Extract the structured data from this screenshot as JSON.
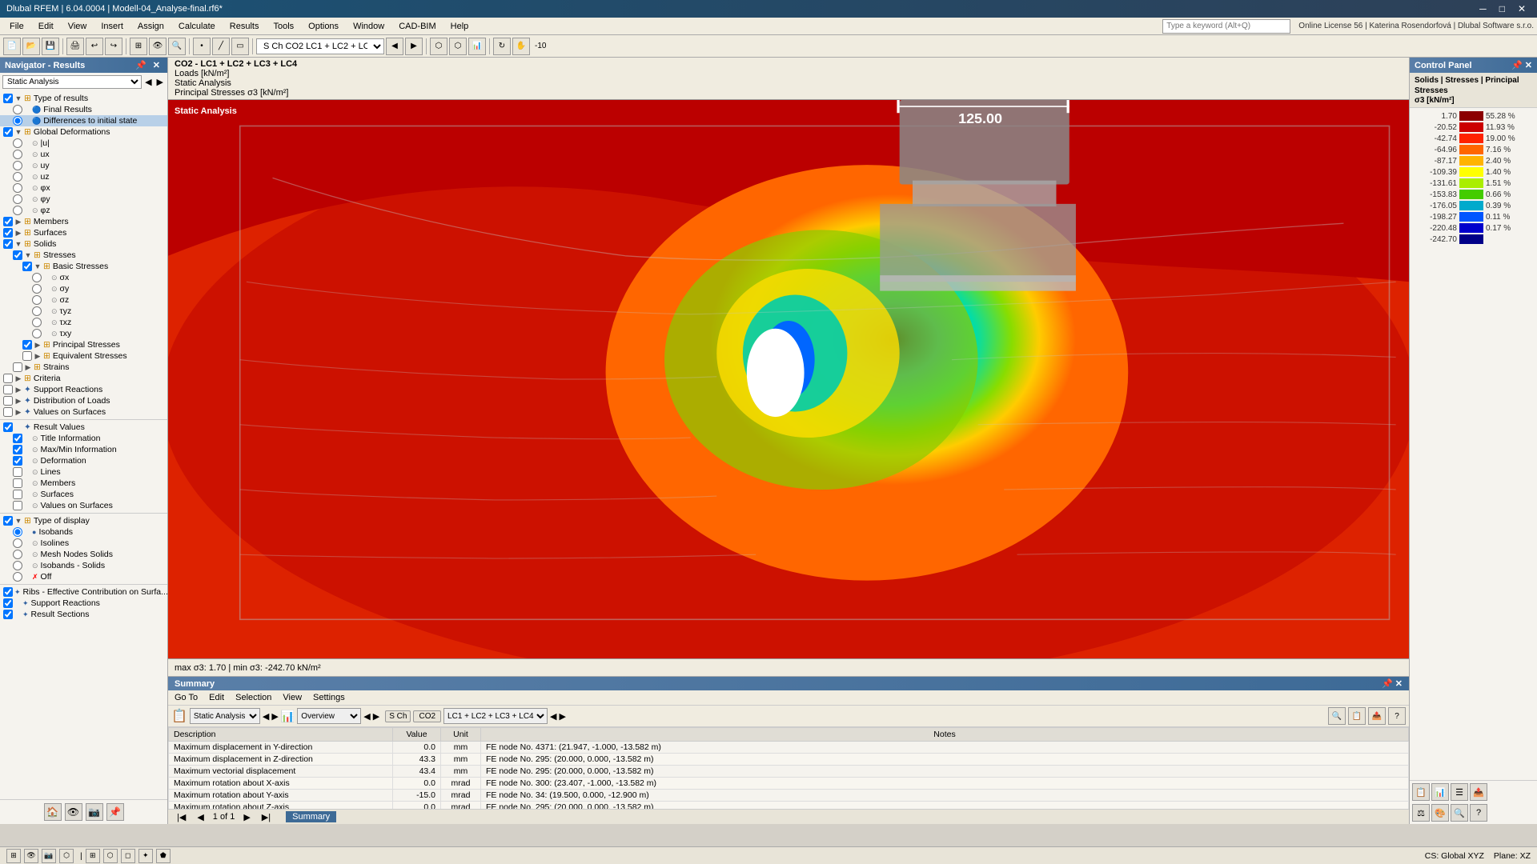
{
  "window": {
    "title": "Dlubal RFEM | 6.04.0004 | Modell-04_Analyse-final.rf6*",
    "controls": [
      "─",
      "□",
      "✕"
    ]
  },
  "menu": {
    "items": [
      "File",
      "Edit",
      "View",
      "Insert",
      "Assign",
      "Calculate",
      "Results",
      "Tools",
      "Options",
      "Window",
      "CAD-BIM",
      "Help"
    ]
  },
  "search_placeholder": "Type a keyword (Alt+Q)",
  "license_info": "Online License 56 | Katerina Rosendorfová | Dlubal Software s.r.o.",
  "navigator": {
    "title": "Navigator - Results",
    "dropdown_value": "Static Analysis",
    "tree": [
      {
        "label": "Type of results",
        "indent": 0,
        "expand": true,
        "checkbox": true,
        "icon": "folder"
      },
      {
        "label": "Final Results",
        "indent": 1,
        "checkbox": false,
        "radio": true
      },
      {
        "label": "Differences to initial state",
        "indent": 1,
        "checkbox": false,
        "radio": true,
        "selected": true
      },
      {
        "label": "Global Deformations",
        "indent": 0,
        "expand": true,
        "checkbox": true,
        "icon": "folder"
      },
      {
        "label": "|u|",
        "indent": 1,
        "radio": true
      },
      {
        "label": "ux",
        "indent": 1,
        "radio": true
      },
      {
        "label": "uy",
        "indent": 1,
        "radio": true
      },
      {
        "label": "uz",
        "indent": 1,
        "radio": true
      },
      {
        "label": "φx",
        "indent": 1,
        "radio": true
      },
      {
        "label": "φy",
        "indent": 1,
        "radio": true
      },
      {
        "label": "φz",
        "indent": 1,
        "radio": true
      },
      {
        "label": "Members",
        "indent": 0,
        "checkbox": true,
        "expand": false,
        "icon": "folder"
      },
      {
        "label": "Surfaces",
        "indent": 0,
        "checkbox": true,
        "expand": false,
        "icon": "folder"
      },
      {
        "label": "Solids",
        "indent": 0,
        "checkbox": true,
        "expand": true,
        "icon": "folder"
      },
      {
        "label": "Stresses",
        "indent": 1,
        "checkbox": true,
        "expand": true,
        "icon": "folder"
      },
      {
        "label": "Basic Stresses",
        "indent": 2,
        "checkbox": true,
        "expand": true,
        "icon": "folder"
      },
      {
        "label": "σx",
        "indent": 3,
        "radio": true
      },
      {
        "label": "σy",
        "indent": 3,
        "radio": true
      },
      {
        "label": "σz",
        "indent": 3,
        "radio": true
      },
      {
        "label": "τyz",
        "indent": 3,
        "radio": true
      },
      {
        "label": "τxz",
        "indent": 3,
        "radio": true
      },
      {
        "label": "τxy",
        "indent": 3,
        "radio": true
      },
      {
        "label": "Principal Stresses",
        "indent": 2,
        "checkbox": true,
        "expand": false,
        "icon": "folder"
      },
      {
        "label": "Equivalent Stresses",
        "indent": 2,
        "checkbox": false,
        "expand": false,
        "icon": "folder"
      },
      {
        "label": "Strains",
        "indent": 1,
        "checkbox": false,
        "expand": false,
        "icon": "folder"
      },
      {
        "label": "Criteria",
        "indent": 0,
        "checkbox": false,
        "expand": false,
        "icon": "folder"
      },
      {
        "label": "Support Reactions",
        "indent": 0,
        "checkbox": false,
        "expand": false,
        "icon": "folder"
      },
      {
        "label": "Distribution of Loads",
        "indent": 0,
        "checkbox": false,
        "expand": false,
        "icon": "folder"
      },
      {
        "label": "Values on Surfaces",
        "indent": 0,
        "checkbox": false,
        "expand": false,
        "icon": "folder"
      },
      {
        "label": "Result Values",
        "indent": 0,
        "checkbox": true,
        "expand": false,
        "icon": "result"
      },
      {
        "label": "Title Information",
        "indent": 1,
        "checkbox": true
      },
      {
        "label": "Max/Min Information",
        "indent": 1,
        "checkbox": true
      },
      {
        "label": "Deformation",
        "indent": 1,
        "checkbox": true
      },
      {
        "label": "Lines",
        "indent": 1,
        "checkbox": false
      },
      {
        "label": "Members",
        "indent": 1,
        "checkbox": false
      },
      {
        "label": "Surfaces",
        "indent": 1,
        "checkbox": false
      },
      {
        "label": "Values on Surfaces",
        "indent": 1,
        "checkbox": false
      },
      {
        "label": "Type of display",
        "indent": 0,
        "checkbox": true,
        "expand": true,
        "icon": "folder"
      },
      {
        "label": "Isobands",
        "indent": 1,
        "radio": true,
        "selected": true
      },
      {
        "label": "Isolines",
        "indent": 1,
        "radio": true
      },
      {
        "label": "Mesh Nodes Solids",
        "indent": 1,
        "radio": true
      },
      {
        "label": "Isobands - Solids",
        "indent": 1,
        "radio": true
      },
      {
        "label": "Off",
        "indent": 1,
        "radio": true,
        "crossed": true
      },
      {
        "label": "Ribs - Effective Contribution on Surfa...",
        "indent": 0,
        "checkbox": true
      },
      {
        "label": "Support Reactions",
        "indent": 0,
        "checkbox": true
      },
      {
        "label": "Result Sections",
        "indent": 0,
        "checkbox": true
      }
    ]
  },
  "canvas_info": {
    "combo": "CO2 - LC1 + LC2 + LC3 + LC4",
    "line1": "Loads [kN/m²]",
    "line2": "Static Analysis",
    "line3": "Principal Stresses σ3 [kN/m²]"
  },
  "canvas_status": {
    "text": "max σ3: 1.70 | min σ3: -242.70 kN/m²"
  },
  "scale_box": {
    "value": "125.00"
  },
  "legend": {
    "title": "Solids | Stresses | Principal Stresses\nσ3 [kN/m²]",
    "rows": [
      {
        "value": "1.70",
        "color": "#8B0000",
        "percent": "55.28 %"
      },
      {
        "value": "-20.52",
        "color": "#CC0000",
        "percent": "11.93 %"
      },
      {
        "value": "-42.74",
        "color": "#FF2200",
        "percent": "19.00 %"
      },
      {
        "value": "-64.96",
        "color": "#FF6600",
        "percent": "7.16 %"
      },
      {
        "value": "-87.17",
        "color": "#FFB300",
        "percent": "2.40 %"
      },
      {
        "value": "-109.39",
        "color": "#FFFF00",
        "percent": "1.40 %"
      },
      {
        "value": "-131.61",
        "color": "#AAEE00",
        "percent": "1.51 %"
      },
      {
        "value": "-153.83",
        "color": "#44CC00",
        "percent": "0.66 %"
      },
      {
        "value": "-176.05",
        "color": "#00AACC",
        "percent": "0.39 %"
      },
      {
        "value": "-198.27",
        "color": "#0055FF",
        "percent": "0.11 %"
      },
      {
        "value": "-220.48",
        "color": "#0000CC",
        "percent": "0.17 %"
      },
      {
        "value": "-242.70",
        "color": "#000088",
        "percent": ""
      }
    ]
  },
  "summary": {
    "title": "Summary",
    "menus": [
      "Go To",
      "Edit",
      "Selection",
      "View",
      "Settings"
    ],
    "static_analysis_label": "Static Analysis",
    "overview_label": "Overview",
    "combo_label": "LC1 + LC2 + LC3 + LC4",
    "table_headers": [
      "Description",
      "Value",
      "Unit",
      "Notes"
    ],
    "rows": [
      {
        "desc": "Maximum displacement in Y-direction",
        "value": "0.0",
        "unit": "mm",
        "note": "FE node No. 4371: (21.947, -1.000, -13.582 m)"
      },
      {
        "desc": "Maximum displacement in Z-direction",
        "value": "43.3",
        "unit": "mm",
        "note": "FE node No. 295: (20.000, 0.000, -13.582 m)"
      },
      {
        "desc": "Maximum vectorial displacement",
        "value": "43.4",
        "unit": "mm",
        "note": "FE node No. 295: (20.000, 0.000, -13.582 m)"
      },
      {
        "desc": "Maximum rotation about X-axis",
        "value": "0.0",
        "unit": "mrad",
        "note": "FE node No. 300: (23.407, -1.000, -13.582 m)"
      },
      {
        "desc": "Maximum rotation about Y-axis",
        "value": "-15.0",
        "unit": "mrad",
        "note": "FE node No. 34: (19.500, 0.000, -12.900 m)"
      },
      {
        "desc": "Maximum rotation about Z-axis",
        "value": "0.0",
        "unit": "mrad",
        "note": "FE node No. 295: (20.000, 0.000, -13.582 m)"
      }
    ],
    "page_info": "1 of 1",
    "tab_label": "Summary"
  },
  "statusbar": {
    "cs_label": "CS: Global XYZ",
    "plane_label": "Plane: XZ"
  }
}
